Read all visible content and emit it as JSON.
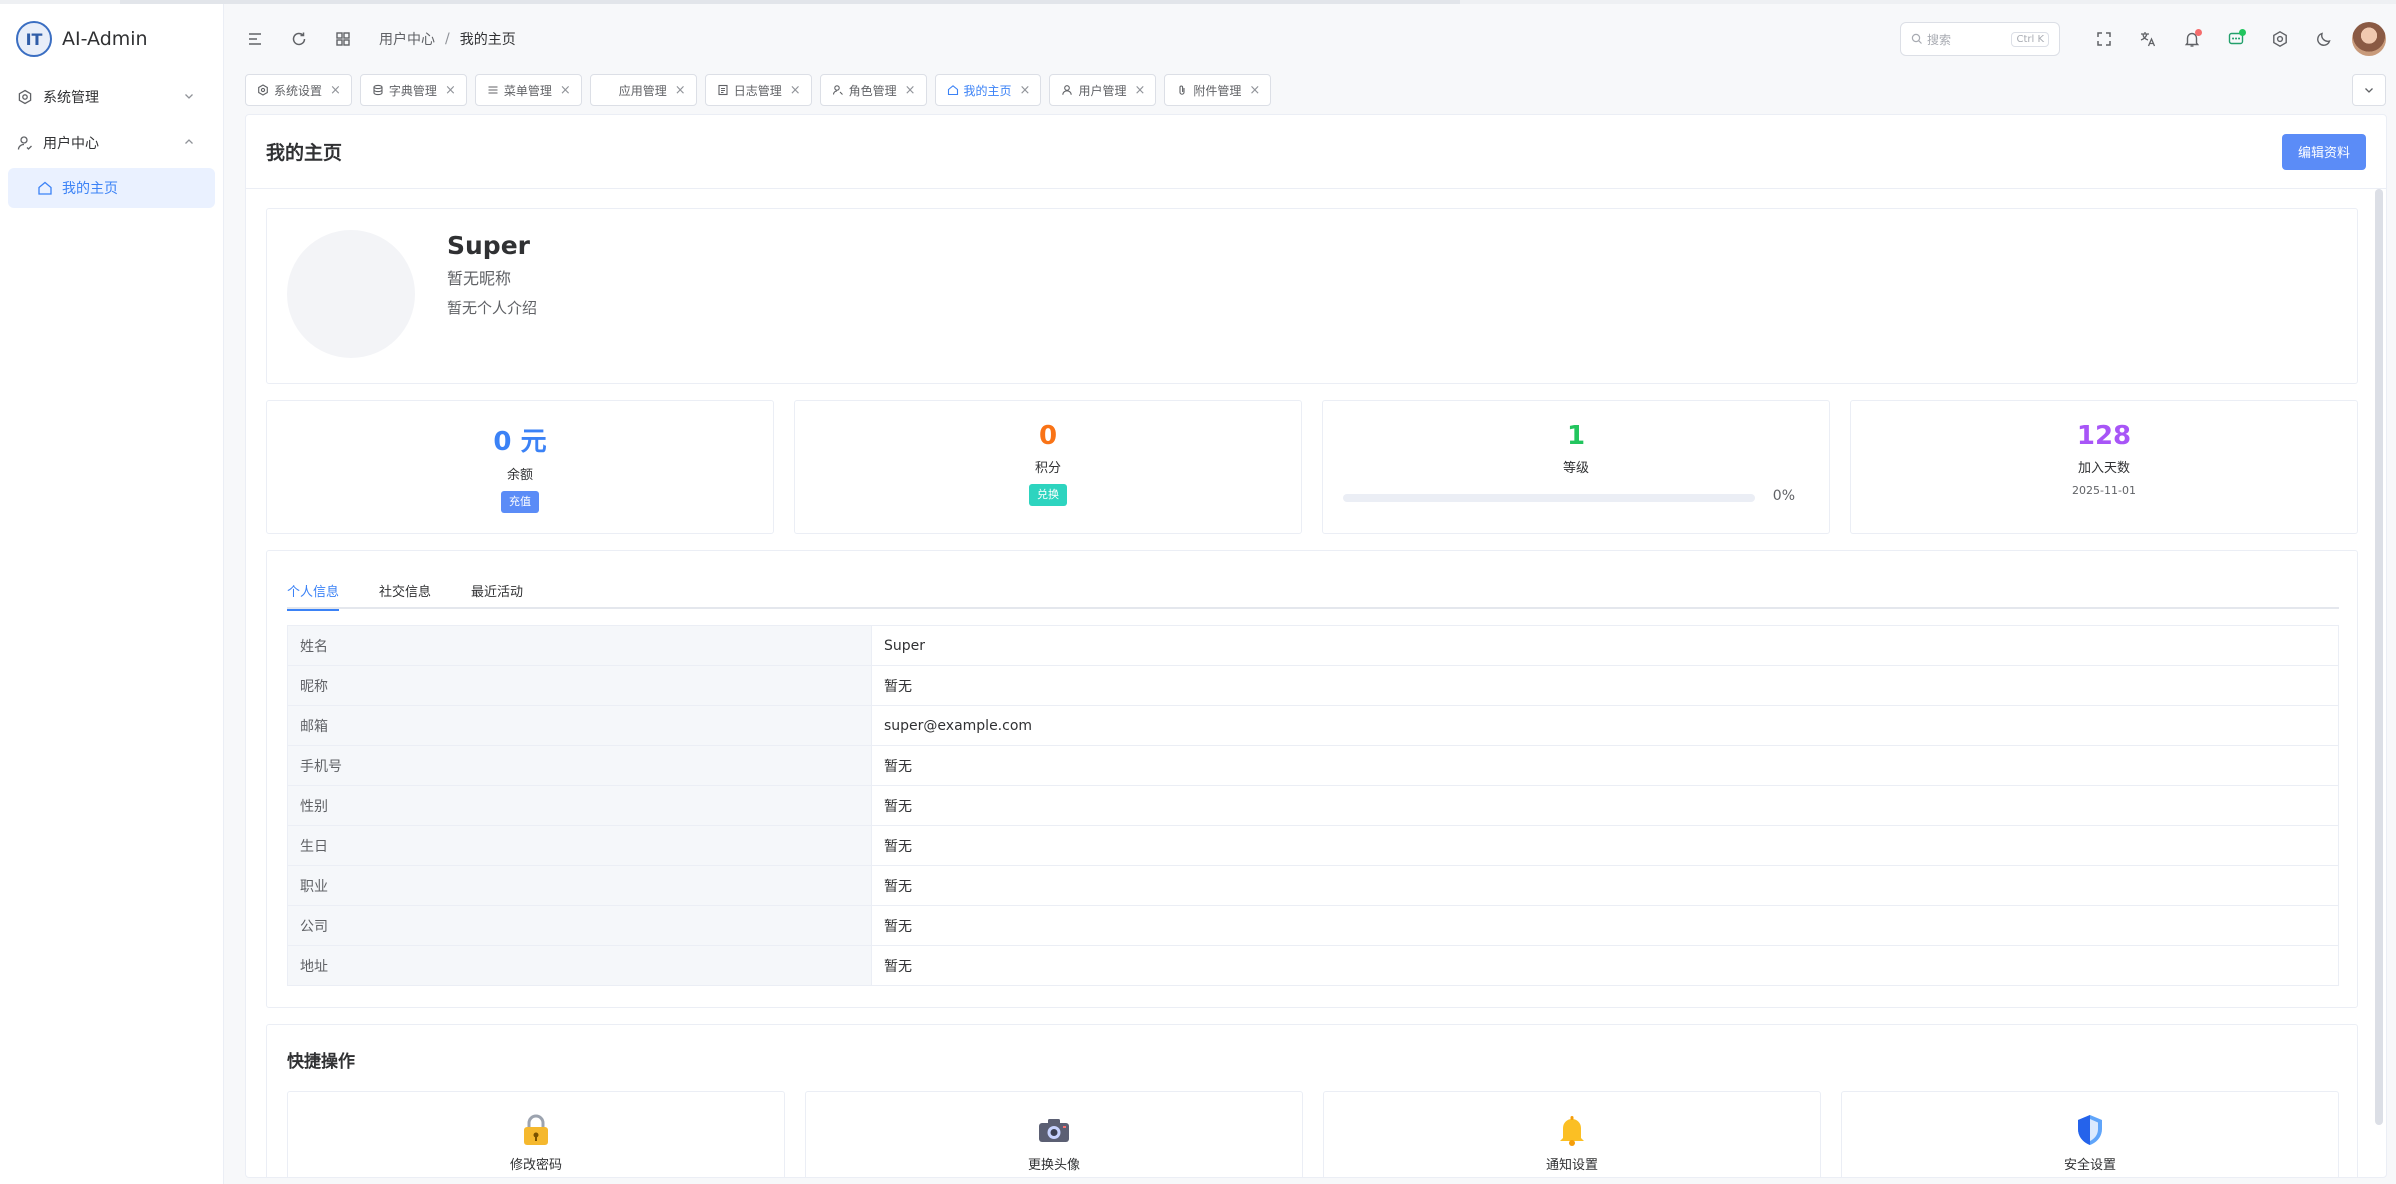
{
  "app": {
    "name": "AI-Admin",
    "logo_text": "IT"
  },
  "sidebar": {
    "items": [
      {
        "label": "系统管理",
        "icon": "settings-icon",
        "expanded": false
      },
      {
        "label": "用户中心",
        "icon": "user-icon",
        "expanded": true
      }
    ],
    "sub_items": [
      {
        "label": "我的主页",
        "icon": "home-icon",
        "active": true
      }
    ]
  },
  "header": {
    "breadcrumb": [
      "用户中心",
      "我的主页"
    ],
    "breadcrumb_sep": "/",
    "search_placeholder": "搜索",
    "search_shortcut": "Ctrl K"
  },
  "tabs": [
    {
      "label": "系统设置",
      "icon": "settings-icon"
    },
    {
      "label": "字典管理",
      "icon": "database-icon"
    },
    {
      "label": "菜单管理",
      "icon": "menu-icon"
    },
    {
      "label": "应用管理",
      "icon": "app-icon"
    },
    {
      "label": "日志管理",
      "icon": "log-icon"
    },
    {
      "label": "角色管理",
      "icon": "role-icon"
    },
    {
      "label": "我的主页",
      "icon": "home-icon",
      "active": true
    },
    {
      "label": "用户管理",
      "icon": "user-icon"
    },
    {
      "label": "附件管理",
      "icon": "attachment-icon"
    }
  ],
  "page": {
    "title": "我的主页",
    "edit_button": "编辑资料"
  },
  "profile": {
    "name": "Super",
    "nickname": "暂无昵称",
    "intro": "暂无个人介绍"
  },
  "stats": {
    "balance": {
      "value": "0 元",
      "label": "余额",
      "action": "充值",
      "color": "#3b82f6",
      "action_color": "#5b8cf7"
    },
    "points": {
      "value": "0",
      "label": "积分",
      "action": "兑换",
      "color": "#f97316",
      "action_color": "#2dd4bf"
    },
    "level": {
      "value": "1",
      "label": "等级",
      "progress": 0,
      "progress_text": "0%",
      "color": "#22c55e"
    },
    "days": {
      "value": "128",
      "label": "加入天数",
      "date": "2025-11-01",
      "color": "#a855f7"
    }
  },
  "info_tabs": [
    "个人信息",
    "社交信息",
    "最近活动"
  ],
  "info_rows": [
    {
      "key": "姓名",
      "value": "Super"
    },
    {
      "key": "昵称",
      "value": "暂无"
    },
    {
      "key": "邮箱",
      "value": "super@example.com"
    },
    {
      "key": "手机号",
      "value": "暂无"
    },
    {
      "key": "性别",
      "value": "暂无"
    },
    {
      "key": "生日",
      "value": "暂无"
    },
    {
      "key": "职业",
      "value": "暂无"
    },
    {
      "key": "公司",
      "value": "暂无"
    },
    {
      "key": "地址",
      "value": "暂无"
    }
  ],
  "quick": {
    "title": "快捷操作",
    "items": [
      {
        "label": "修改密码",
        "icon": "lock-icon"
      },
      {
        "label": "更换头像",
        "icon": "camera-icon"
      },
      {
        "label": "通知设置",
        "icon": "bell-icon"
      },
      {
        "label": "安全设置",
        "icon": "shield-icon"
      }
    ]
  }
}
